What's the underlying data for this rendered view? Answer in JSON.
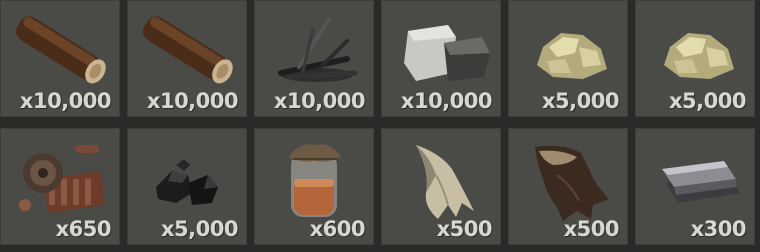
{
  "inventory": {
    "slots": [
      {
        "item_icon": "wood-log-icon",
        "quantity": "x10,000"
      },
      {
        "item_icon": "wood-log-icon",
        "quantity": "x10,000"
      },
      {
        "item_icon": "charcoal-sticks-icon",
        "quantity": "x10,000"
      },
      {
        "item_icon": "stone-rocks-icon",
        "quantity": "x10,000"
      },
      {
        "item_icon": "sulfur-ore-icon",
        "quantity": "x5,000"
      },
      {
        "item_icon": "sulfur-ore-icon",
        "quantity": "x5,000"
      },
      {
        "item_icon": "scrap-metal-parts-icon",
        "quantity": "x650"
      },
      {
        "item_icon": "coal-lumps-icon",
        "quantity": "x5,000"
      },
      {
        "item_icon": "jar-of-powder-icon",
        "quantity": "x600"
      },
      {
        "item_icon": "cloth-fabric-icon",
        "quantity": "x500"
      },
      {
        "item_icon": "leather-hide-icon",
        "quantity": "x500"
      },
      {
        "item_icon": "metal-ingot-icon",
        "quantity": "x300"
      }
    ]
  },
  "colors": {
    "background": "#2a2a28",
    "slot": "#4a4a47",
    "quantity_text": "#d8d8d2"
  }
}
